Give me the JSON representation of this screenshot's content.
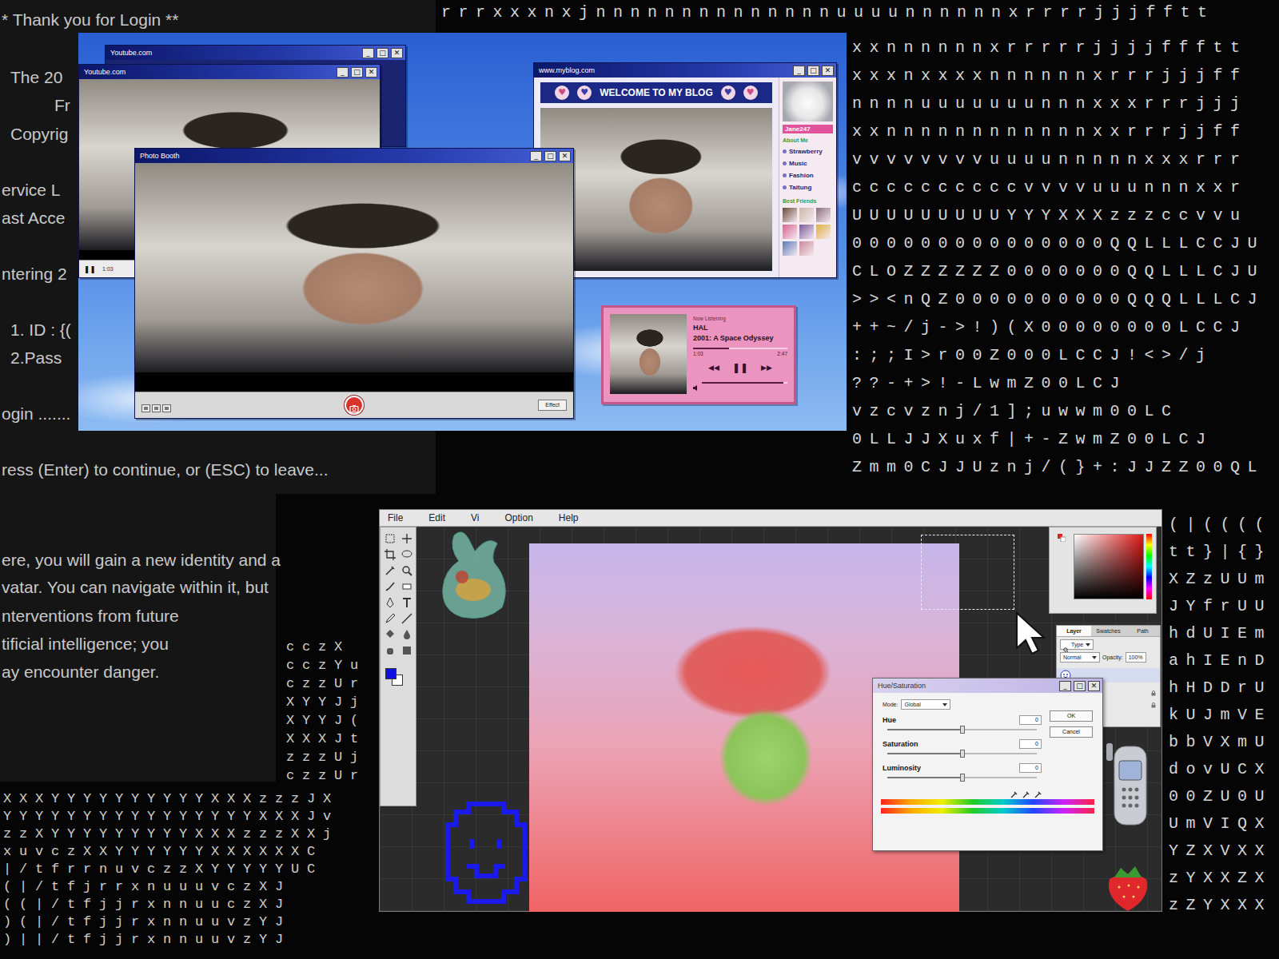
{
  "terminal": {
    "lines": [
      "* Thank you for Login **",
      "The 20",
      "Fr",
      "Copyrig",
      "ervice L",
      "ast Acce",
      "ntering 2",
      "1. ID : {(",
      "2.Pass",
      "ogin .......",
      "ress (Enter) to continue, or (ESC) to leave...",
      "ere, you will gain a new identity and a",
      "vatar. You can navigate within it, but",
      "nterventions from future",
      "tificial intelligence; you",
      "ay encounter danger."
    ]
  },
  "char_grid": {
    "top_row": "rrrxxxnxjnnnnnnnnnnnnnnuuuunnnnnnxrrrrjjjfftt",
    "right_rows": [
      "xxnnnnnnxrrrrrjjjjffftt",
      "xxxnxxxxnnnnnnxrrrjjjff",
      "nnnnuuuuuuunnnxxxrrrjjj",
      "xxnnnnnnnnnnnnxxrrrjjff",
      "vvvvvvvvuuuunnnnnxxxrrr",
      "ccccccccccvvvvuuunnnxxr",
      "UUUUUUUUUYYYXXXzzzccvvu",
      "000000000000000QQLLLCCJU",
      "CLOZZZZZZ0000000QQLLLCJU",
      ">><nQZ0000000000QQQLLLCJ",
      "++~/j->!)(X00000000LCCJ",
      ":;;I>r00Z000LCCJ!<>/j",
      "??-+>!-LwmZ00LCJ",
      "vzcvznj/1];uwwm00LC",
      "0LLJJXuxf|+-ZwmZ00LCJ",
      "Zmm0CJJUznj/(}+:JJZZ00QL"
    ],
    "strip_rows": [
      "(|((((",
      "tt}|{}",
      "XZzUUm",
      "JYfrUU",
      "hdUIEm",
      "ahIEnD",
      "hHDDrU",
      "kUJmVE",
      "bbVXmU",
      "dovUCX",
      "00ZU0U",
      "UmVIQX",
      "YZXVXX",
      "zYXXZX",
      "zZYXXX"
    ],
    "left_rows": [
      "XXXYYYYYYYYYYXXXzzzJX",
      "YYYYYYYYYYYYYYYYXXXJv",
      "zzXYYYYYYYYYXXXzzzXXj",
      "xuvczXXYYYYYYXXXXXXC",
      "|/tfrrnuvczzXYYYYYUC",
      "(|/tfjrrxnuuuvczXJ",
      "((|/tfjjrxnnuuczXJ",
      ")(|/tfjjrxnnuuvzYJ",
      ")||/tfjjrxnnuuvzYJ"
    ],
    "small_rows": [
      "cczX",
      "cczYu",
      "czzUr",
      "XYYJj",
      "XYYJ(",
      "XXXJt",
      "zzzUj",
      "czzUr"
    ]
  },
  "window_controls": [
    "_",
    "□",
    "✕"
  ],
  "youtube_back": {
    "title": "Youtube.com"
  },
  "youtube": {
    "title": "Youtube.com",
    "pause": "❚❚",
    "time": "1:03"
  },
  "photo_booth": {
    "title": "Photo Booth",
    "effect_button": "Effect"
  },
  "blog": {
    "title": "www.myblog.com",
    "header": "WELCOME TO MY BLOG",
    "hearts": [
      "♥",
      "♥",
      "♥",
      "♥"
    ],
    "username": "Jane247",
    "about_label": "About Me",
    "menu": [
      "Strawberry",
      "Music",
      "Fashion",
      "Taitung"
    ],
    "friends_label": "Best Friends"
  },
  "music_player": {
    "caption": "Now Listening",
    "artist": "HAL",
    "track": "2001: A Space Odyssey",
    "elapsed": "1:03",
    "duration": "2:47",
    "progress": {
      "level": 0.38
    },
    "controls": [
      "◀◀",
      "❚❚",
      "▶▶"
    ],
    "volume": {
      "level": 0.95
    }
  },
  "editor": {
    "menu": [
      "File",
      "Edit",
      "Vi",
      "Option",
      "Help"
    ],
    "layers_panel": {
      "tabs": [
        {
          "label": "Layer",
          "selected": true
        },
        {
          "label": "Swatches",
          "selected": false
        },
        {
          "label": "Path",
          "selected": false
        }
      ],
      "filter": "Type",
      "blend_mode": "Normal",
      "opacity_label": "Opacity:",
      "opacity": "100%"
    }
  },
  "hue_dialog": {
    "title": "Hue/Saturation",
    "mode_label": "Mode:",
    "mode": "Global",
    "sliders": [
      {
        "label": "Hue",
        "value": "0",
        "level": 0.5
      },
      {
        "label": "Saturation",
        "value": "0",
        "level": 0.5
      },
      {
        "label": "Luminosity",
        "value": "0",
        "level": 0.5
      }
    ],
    "buttons": [
      "OK",
      "Cancel"
    ]
  }
}
